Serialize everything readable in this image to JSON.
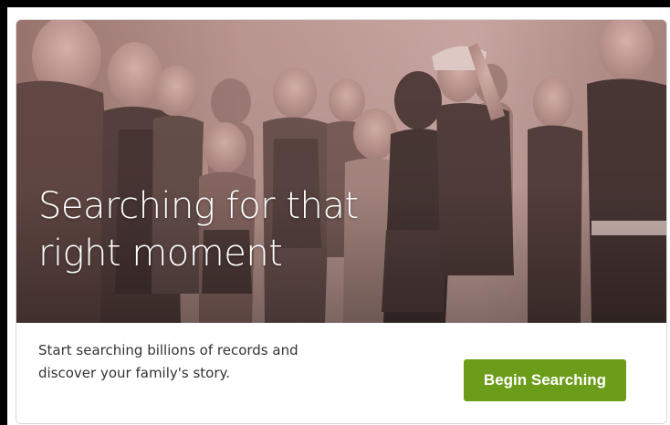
{
  "hero": {
    "title_line1": "Searching for that",
    "title_line2": "right moment"
  },
  "promo": {
    "description_line1": "Start searching billions of records and",
    "description_line2": "discover your family's story.",
    "cta_label": "Begin Searching"
  },
  "colors": {
    "cta_background": "#6c9d1a",
    "photo_tint": "#b88a84",
    "page_border": "#000000"
  }
}
